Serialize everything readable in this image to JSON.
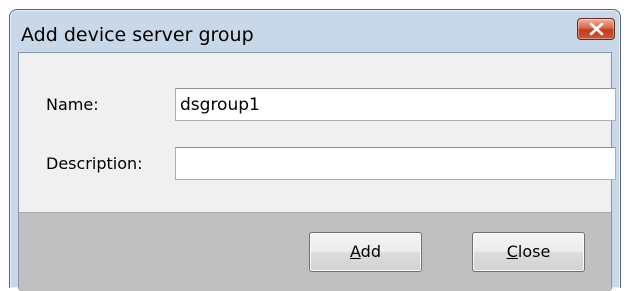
{
  "window": {
    "title": "Add device server group",
    "close_icon": "close-x-icon"
  },
  "form": {
    "name_label": "Name:",
    "name_value": "dsgroup1",
    "description_label": "Description:",
    "description_value": ""
  },
  "buttons": {
    "add": {
      "mnemonic": "A",
      "rest": "dd"
    },
    "close": {
      "mnemonic": "C",
      "rest": "lose"
    }
  },
  "colors": {
    "frame": "#c9d8e9",
    "client": "#f0f0f0",
    "footer": "#c0c0c0",
    "close_button": "#c13a1c"
  }
}
